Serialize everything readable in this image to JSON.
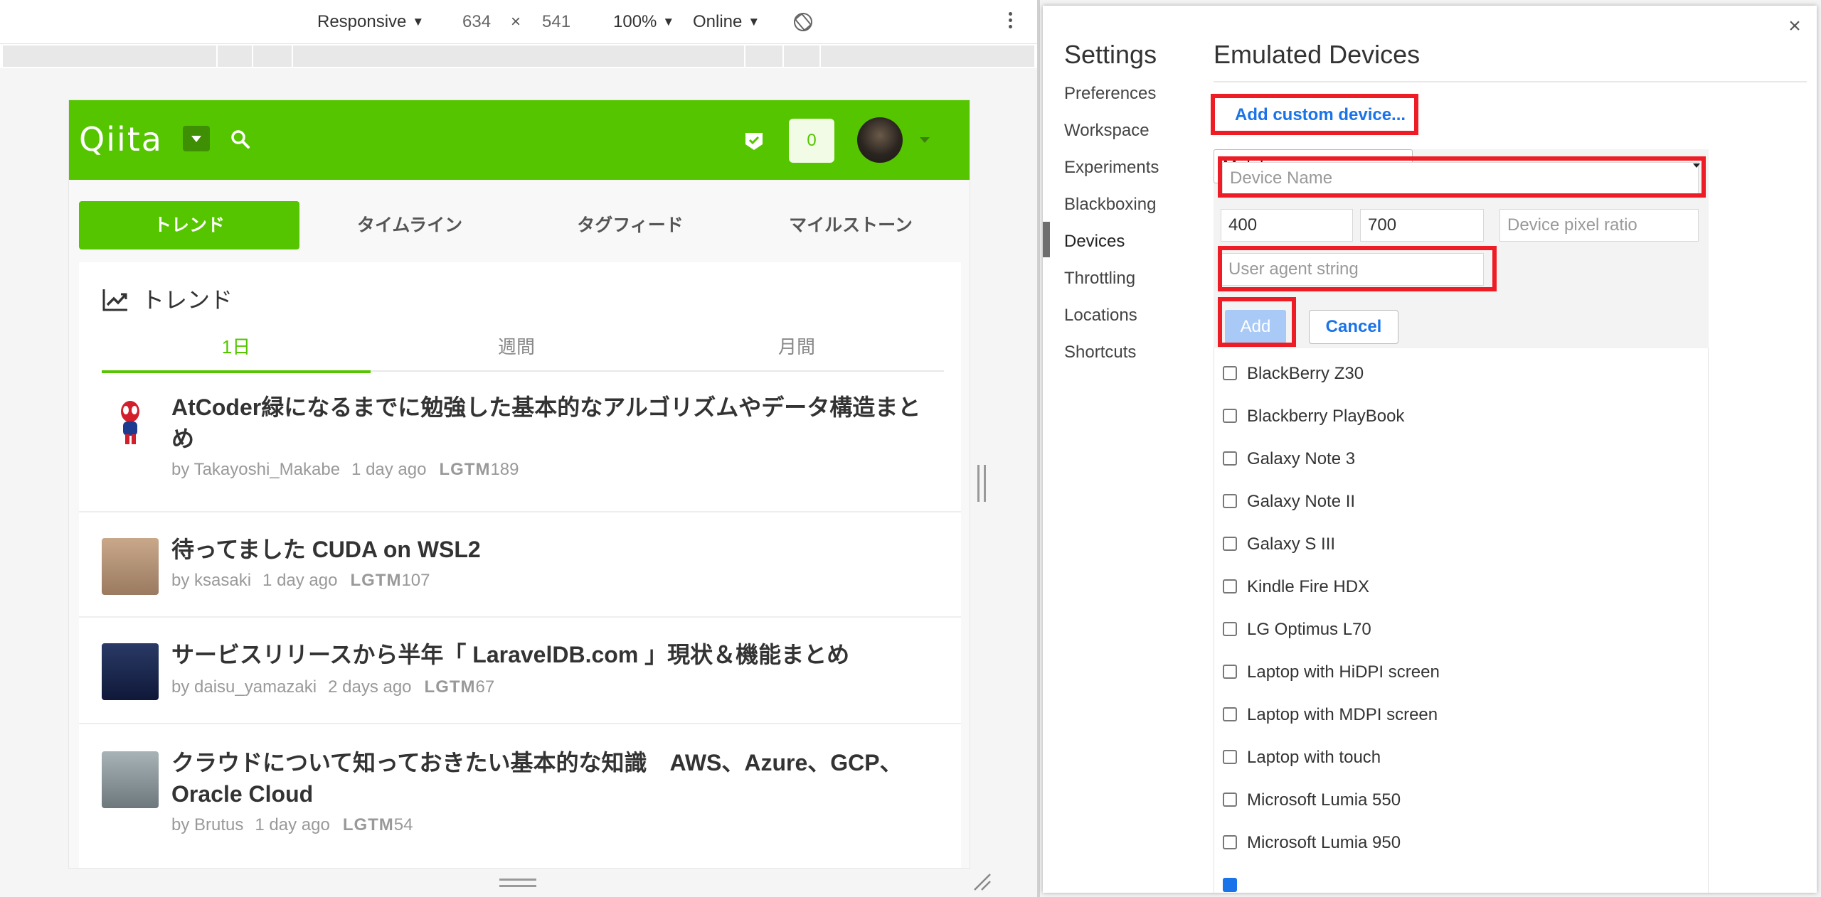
{
  "toolbar": {
    "device_mode": "Responsive",
    "width": "634",
    "times": "×",
    "height": "541",
    "zoom": "100%",
    "throttle": "Online"
  },
  "qiita": {
    "logo": "Qiita",
    "notifications": "0",
    "tabs": [
      "トレンド",
      "タイムライン",
      "タグフィード",
      "マイルストーン"
    ],
    "section_title": "トレンド",
    "periods": [
      "1日",
      "週間",
      "月間"
    ],
    "articles": [
      {
        "title": "AtCoder緑になるまでに勉強した基本的なアルゴリズムやデータ構造まとめ",
        "author": "by Takayoshi_Makabe",
        "time": "1 day ago",
        "lgtm_label": "LGTM",
        "lgtm": "189"
      },
      {
        "title": "待ってました CUDA on WSL2",
        "author": "by ksasaki",
        "time": "1 day ago",
        "lgtm_label": "LGTM",
        "lgtm": "107"
      },
      {
        "title": "サービスリリースから半年「 LaravelDB.com 」現状＆機能まとめ",
        "author": "by daisu_yamazaki",
        "time": "2 days ago",
        "lgtm_label": "LGTM",
        "lgtm": "67"
      },
      {
        "title": "クラウドについて知っておきたい基本的な知識　AWS、Azure、GCP、Oracle Cloud",
        "author": "by Brutus",
        "time": "1 day ago",
        "lgtm_label": "LGTM",
        "lgtm": "54"
      }
    ]
  },
  "settings": {
    "title": "Settings",
    "close": "×",
    "nav": [
      "Preferences",
      "Workspace",
      "Experiments",
      "Blackboxing",
      "Devices",
      "Throttling",
      "Locations",
      "Shortcuts"
    ],
    "active_nav": "Devices",
    "content_title": "Emulated Devices",
    "add_custom": "Add custom device...",
    "form": {
      "name_placeholder": "Device Name",
      "width": "400",
      "height": "700",
      "dpr_placeholder": "Device pixel ratio",
      "ua_placeholder": "User agent string",
      "type": "Mobile",
      "add": "Add",
      "cancel": "Cancel"
    },
    "devices": [
      "BlackBerry Z30",
      "Blackberry PlayBook",
      "Galaxy Note 3",
      "Galaxy Note II",
      "Galaxy S III",
      "Kindle Fire HDX",
      "LG Optimus L70",
      "Laptop with HiDPI screen",
      "Laptop with MDPI screen",
      "Laptop with touch",
      "Microsoft Lumia 550",
      "Microsoft Lumia 950"
    ]
  },
  "colors": {
    "qiita_green": "#55c500",
    "link_blue": "#1a73e8",
    "highlight_red": "#ee1c24"
  }
}
